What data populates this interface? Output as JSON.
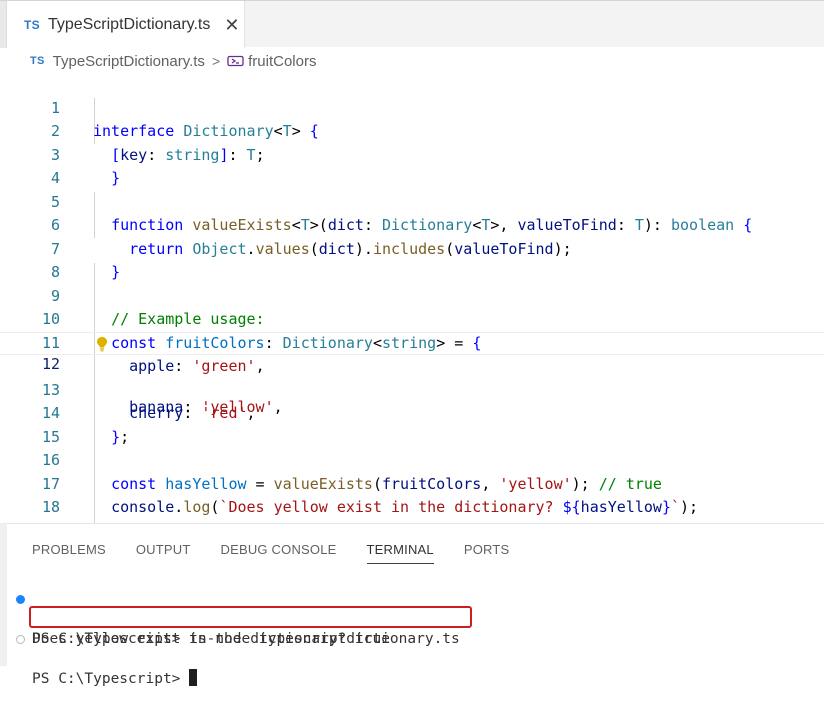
{
  "tab": {
    "lang_badge": "TS",
    "filename": "TypeScriptDictionary.ts",
    "close_glyph": "✕"
  },
  "breadcrumb": {
    "lang_badge": "TS",
    "file": "TypeScriptDictionary.ts",
    "separator": ">",
    "symbol": "fruitColors",
    "symbol_icon": "symbol-variable-icon"
  },
  "editor": {
    "line_numbers": [
      "1",
      "2",
      "3",
      "4",
      "5",
      "6",
      "7",
      "8",
      "9",
      "10",
      "11",
      "12",
      "13",
      "14",
      "15",
      "16",
      "17",
      "18"
    ],
    "current_line": 12,
    "lightbulb_icon": "lightbulb-icon"
  },
  "panel": {
    "tabs": [
      "PROBLEMS",
      "OUTPUT",
      "DEBUG CONSOLE",
      "TERMINAL",
      "PORTS"
    ],
    "active_tab": "TERMINAL"
  },
  "terminal": {
    "line1_prompt": "PS C:\\Typescript> ",
    "line1_command": "ts-node typescriptdictionary.ts",
    "line2_output": "Does yellow exist in the dictionary? true",
    "line3_prompt": "PS C:\\Typescript> "
  },
  "colors": {
    "keyword": "#0000ff",
    "type": "#267f99",
    "function": "#795e26",
    "variable": "#001080",
    "string": "#a31515",
    "comment": "#008000",
    "line_number": "#237893",
    "ts_badge": "#3178c6",
    "highlight_box": "#cc1f1f",
    "terminal_dot": "#1a85ff"
  }
}
